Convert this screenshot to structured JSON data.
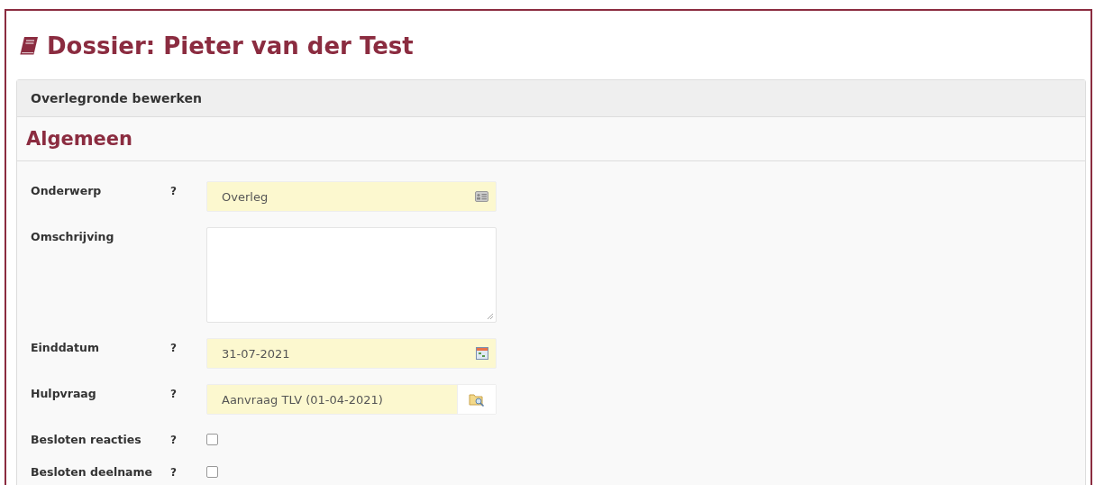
{
  "page_title": "Dossier: Pieter van der Test",
  "panel": {
    "header": "Overlegronde bewerken",
    "section_title": "Algemeen",
    "fields": [
      {
        "kind": "text",
        "label": "Onderwerp",
        "help": "?",
        "value": "Overleg"
      },
      {
        "kind": "textarea",
        "label": "Omschrijving"
      },
      {
        "kind": "date",
        "label": "Einddatum",
        "help": "?",
        "value": "31-07-2021"
      },
      {
        "kind": "lookup",
        "label": "Hulpvraag",
        "help": "?",
        "value": "Aanvraag TLV (01-04-2021)"
      },
      {
        "kind": "checkbox",
        "label": "Besloten reacties",
        "help": "?",
        "checked": false
      },
      {
        "kind": "checkbox",
        "label": "Besloten deelname",
        "help": "?",
        "checked": false
      }
    ]
  }
}
